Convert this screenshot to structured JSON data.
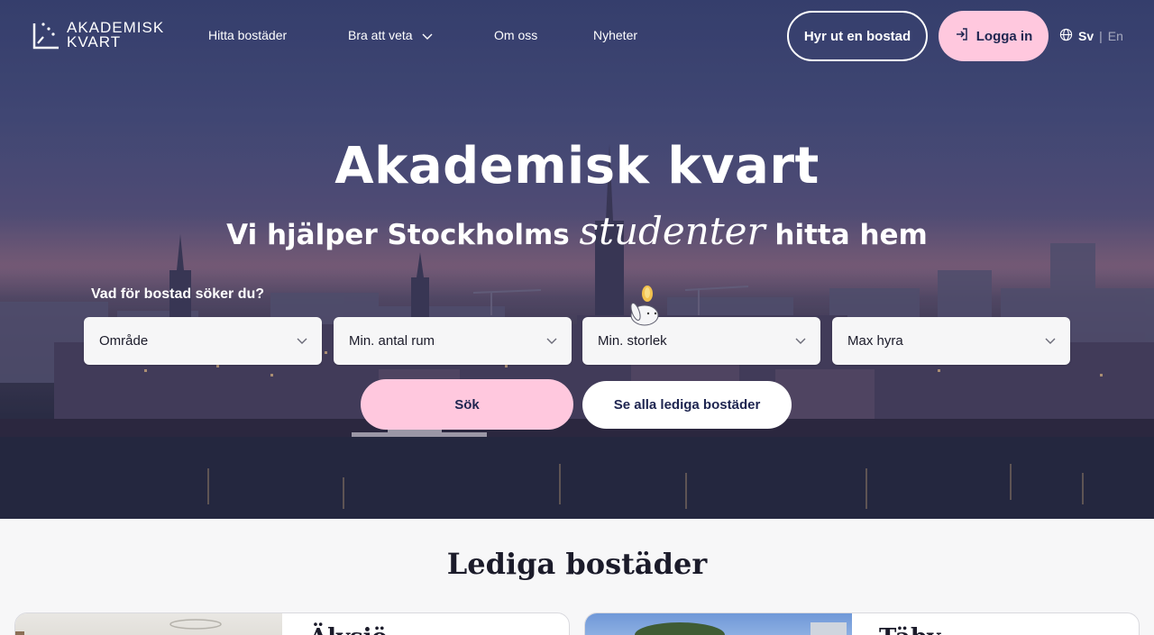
{
  "brand": {
    "line1": "AKADEMISK",
    "line2": "KVART"
  },
  "nav": {
    "links": [
      "Hitta bostäder",
      "Bra att veta",
      "Om oss",
      "Nyheter"
    ],
    "rent_out_label": "Hyr ut en bostad",
    "login_label": "Logga in",
    "lang_active": "Sv",
    "lang_sep": "|",
    "lang_other": "En"
  },
  "hero": {
    "title": "Akademisk kvart",
    "subtitle_before": "Vi hjälper Stockholms",
    "subtitle_emph": "studenter",
    "subtitle_after": "hitta hem"
  },
  "search": {
    "question": "Vad för bostad söker du?",
    "filters": [
      "Område",
      "Min. antal rum",
      "Min. storlek",
      "Max hyra"
    ],
    "search_label": "Sök",
    "all_label": "Se alla lediga bostäder"
  },
  "listings": {
    "title": "Lediga bostäder",
    "cards": [
      {
        "title": "Älvsjö"
      },
      {
        "title": "Täby"
      }
    ]
  },
  "colors": {
    "accent_pink": "#ffc8de",
    "navy": "#1e2550"
  },
  "icons": {
    "login": "login-arrow-icon",
    "language": "globe-icon",
    "dropdown": "chevron-down-icon"
  }
}
